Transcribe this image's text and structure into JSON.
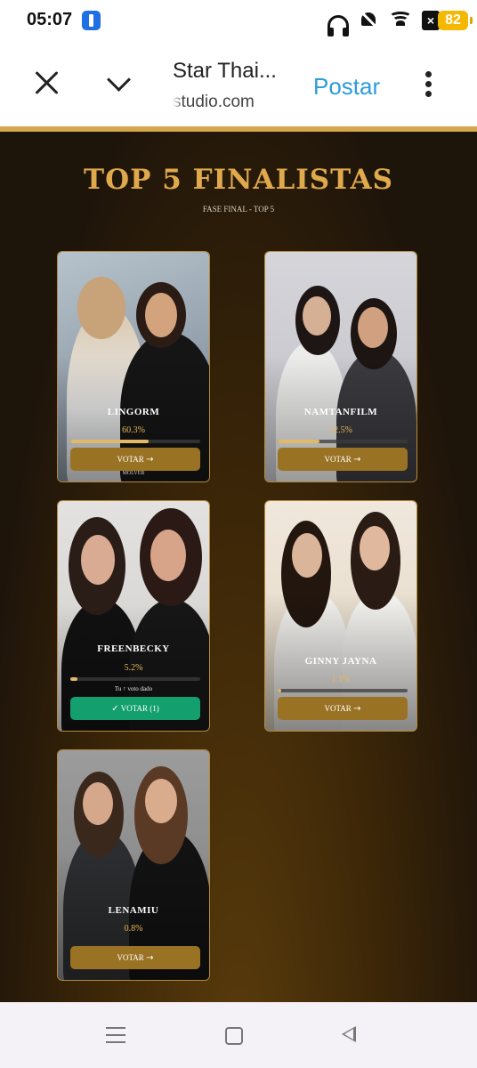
{
  "status_bar": {
    "time": "05:07",
    "battery": "82",
    "icons": [
      "flashlight-icon",
      "headphones-icon",
      "bell-off-icon",
      "wifi-icon",
      "sim-off-icon",
      "battery-icon"
    ]
  },
  "browser": {
    "title": "Star Thai...",
    "url": "studio.com",
    "post_label": "Postar",
    "icons": [
      "close-icon",
      "chevron-down-icon",
      "more-vert-icon"
    ]
  },
  "page": {
    "title": "TOP 5 FINALISTAS",
    "subtitle": "FASE FINAL - TOP 5",
    "accent": "#e0a94c",
    "cards": [
      {
        "name": "LINGORM",
        "percent": "60.3%",
        "progress": 0.603,
        "vote_label": "VOTAR",
        "extra": "MOLVER"
      },
      {
        "name": "NAMTANFILM",
        "percent": "32.5%",
        "progress": 0.325,
        "vote_label": "VOTAR"
      },
      {
        "name": "FREENBECKY",
        "percent": "5.2%",
        "progress": 0.052,
        "vote_label": "VOTAR (1)",
        "voted_note": "Tu ↑ voto dado",
        "voted": true
      },
      {
        "name": "GINNY JAYNA",
        "percent": "1.1%",
        "progress": 0.011,
        "vote_label": "VOTAR"
      },
      {
        "name": "LENAMIU",
        "percent": "0.8%",
        "progress": 0.008,
        "vote_label": "VOTAR"
      }
    ]
  },
  "nav": {
    "icons": [
      "recents-icon",
      "home-icon",
      "back-icon"
    ]
  }
}
